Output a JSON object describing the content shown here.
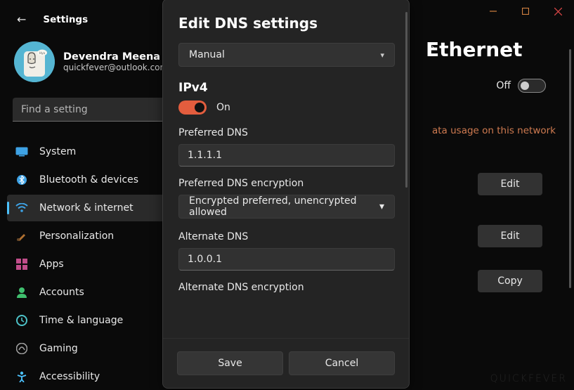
{
  "window": {
    "title": "Settings"
  },
  "user": {
    "name": "Devendra Meena",
    "email": "quickfever@outlook.com"
  },
  "search": {
    "placeholder": "Find a setting"
  },
  "nav": {
    "items": [
      {
        "label": "System"
      },
      {
        "label": "Bluetooth & devices"
      },
      {
        "label": "Network & internet"
      },
      {
        "label": "Personalization"
      },
      {
        "label": "Apps"
      },
      {
        "label": "Accounts"
      },
      {
        "label": "Time & language"
      },
      {
        "label": "Gaming"
      },
      {
        "label": "Accessibility"
      }
    ],
    "active_index": 2,
    "icon_colors": {
      "system": "#3ea2e5",
      "bluetooth": "#3ea2e5",
      "network": "#3ea2e5",
      "personalization": "#b07030",
      "apps": "#c14d8a",
      "accounts": "#3fbf6e",
      "time": "#4dc2c8",
      "gaming": "#a0a0a0",
      "accessibility": "#4cc2ff"
    }
  },
  "page": {
    "title": "Ethernet",
    "metered_state": "Off",
    "data_usage_link": "ata usage on this network",
    "row_buttons": [
      "Edit",
      "Edit",
      "Copy"
    ]
  },
  "dialog": {
    "title": "Edit DNS settings",
    "mode_select": "Manual",
    "ipv4": {
      "heading": "IPv4",
      "toggle_state": "On",
      "preferred_dns_label": "Preferred DNS",
      "preferred_dns_value": "1.1.1.1",
      "preferred_enc_label": "Preferred DNS encryption",
      "preferred_enc_value": "Encrypted preferred, unencrypted allowed",
      "alternate_dns_label": "Alternate DNS",
      "alternate_dns_value": "1.0.0.1",
      "alternate_enc_label": "Alternate DNS encryption"
    },
    "save_label": "Save",
    "cancel_label": "Cancel"
  },
  "watermark": "QUICKFEVER"
}
